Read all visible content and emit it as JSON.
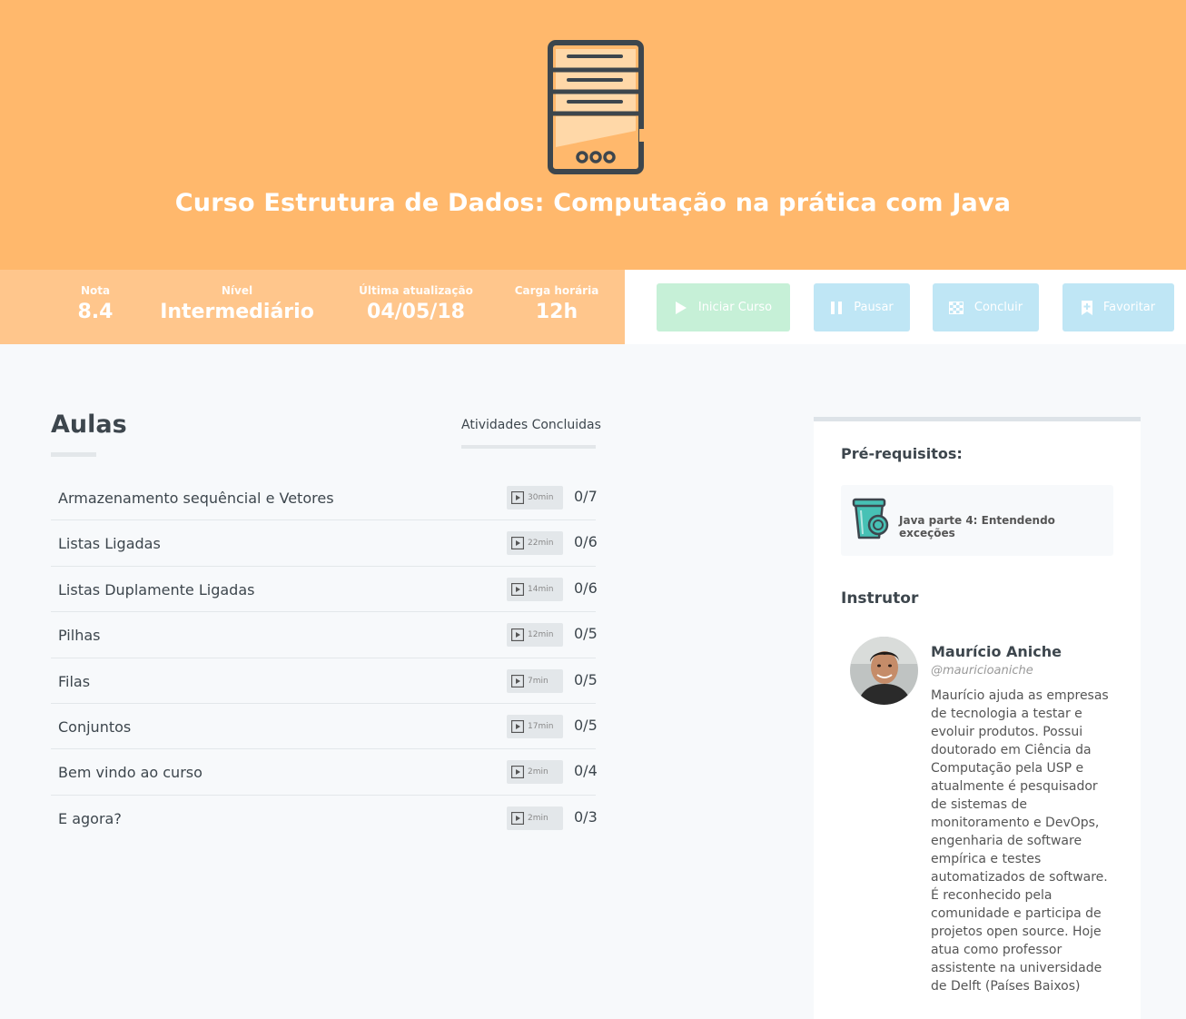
{
  "course": {
    "title": "Curso Estrutura de Dados: Computação na prática com Java",
    "icon": "server-icon"
  },
  "stats": [
    {
      "label": "Nota",
      "value": "8.4"
    },
    {
      "label": "Nível",
      "value": "Intermediário"
    },
    {
      "label": "Última atualização",
      "value": "04/05/18"
    },
    {
      "label": "Carga horária",
      "value": "12h"
    }
  ],
  "actions": {
    "start": "Iniciar Curso",
    "pause": "Pausar",
    "finish": "Concluir",
    "favorite": "Favoritar"
  },
  "lessons_section": {
    "title": "Aulas",
    "activities_label": "Atividades Concluidas",
    "items": [
      {
        "name": "Armazenamento sequêncial e Vetores",
        "duration": "30min",
        "progress": "0/7"
      },
      {
        "name": "Listas Ligadas",
        "duration": "22min",
        "progress": "0/6"
      },
      {
        "name": "Listas Duplamente Ligadas",
        "duration": "14min",
        "progress": "0/6"
      },
      {
        "name": "Pilhas",
        "duration": "12min",
        "progress": "0/5"
      },
      {
        "name": "Filas",
        "duration": "7min",
        "progress": "0/5"
      },
      {
        "name": "Conjuntos",
        "duration": "17min",
        "progress": "0/5"
      },
      {
        "name": "Bem vindo ao curso",
        "duration": "2min",
        "progress": "0/4"
      },
      {
        "name": "E agora?",
        "duration": "2min",
        "progress": "0/3"
      }
    ]
  },
  "sidebar": {
    "prereq_title": "Pré-requisitos:",
    "prereq_course": "Java parte 4: Entendendo exceções",
    "instructor_title": "Instrutor",
    "instructor": {
      "name": "Maurício Aniche",
      "handle": "@mauricioaniche",
      "bio": "Maurício ajuda as empresas de tecnologia a testar e evoluir produtos. Possui doutorado em Ciência da Computação pela USP e atualmente é pesquisador de sistemas de monitoramento e DevOps, engenharia de software empírica e testes automatizados de software. É reconhecido pela comunidade e participa de projetos open source. Hoje atua como professor assistente na universidade de Delft (Países Baixos)"
    }
  },
  "colors": {
    "hero": "#ffb86c",
    "stats": "#ffc68c",
    "start_button": "#c6f0d7",
    "action_button": "#bfe6f5"
  }
}
